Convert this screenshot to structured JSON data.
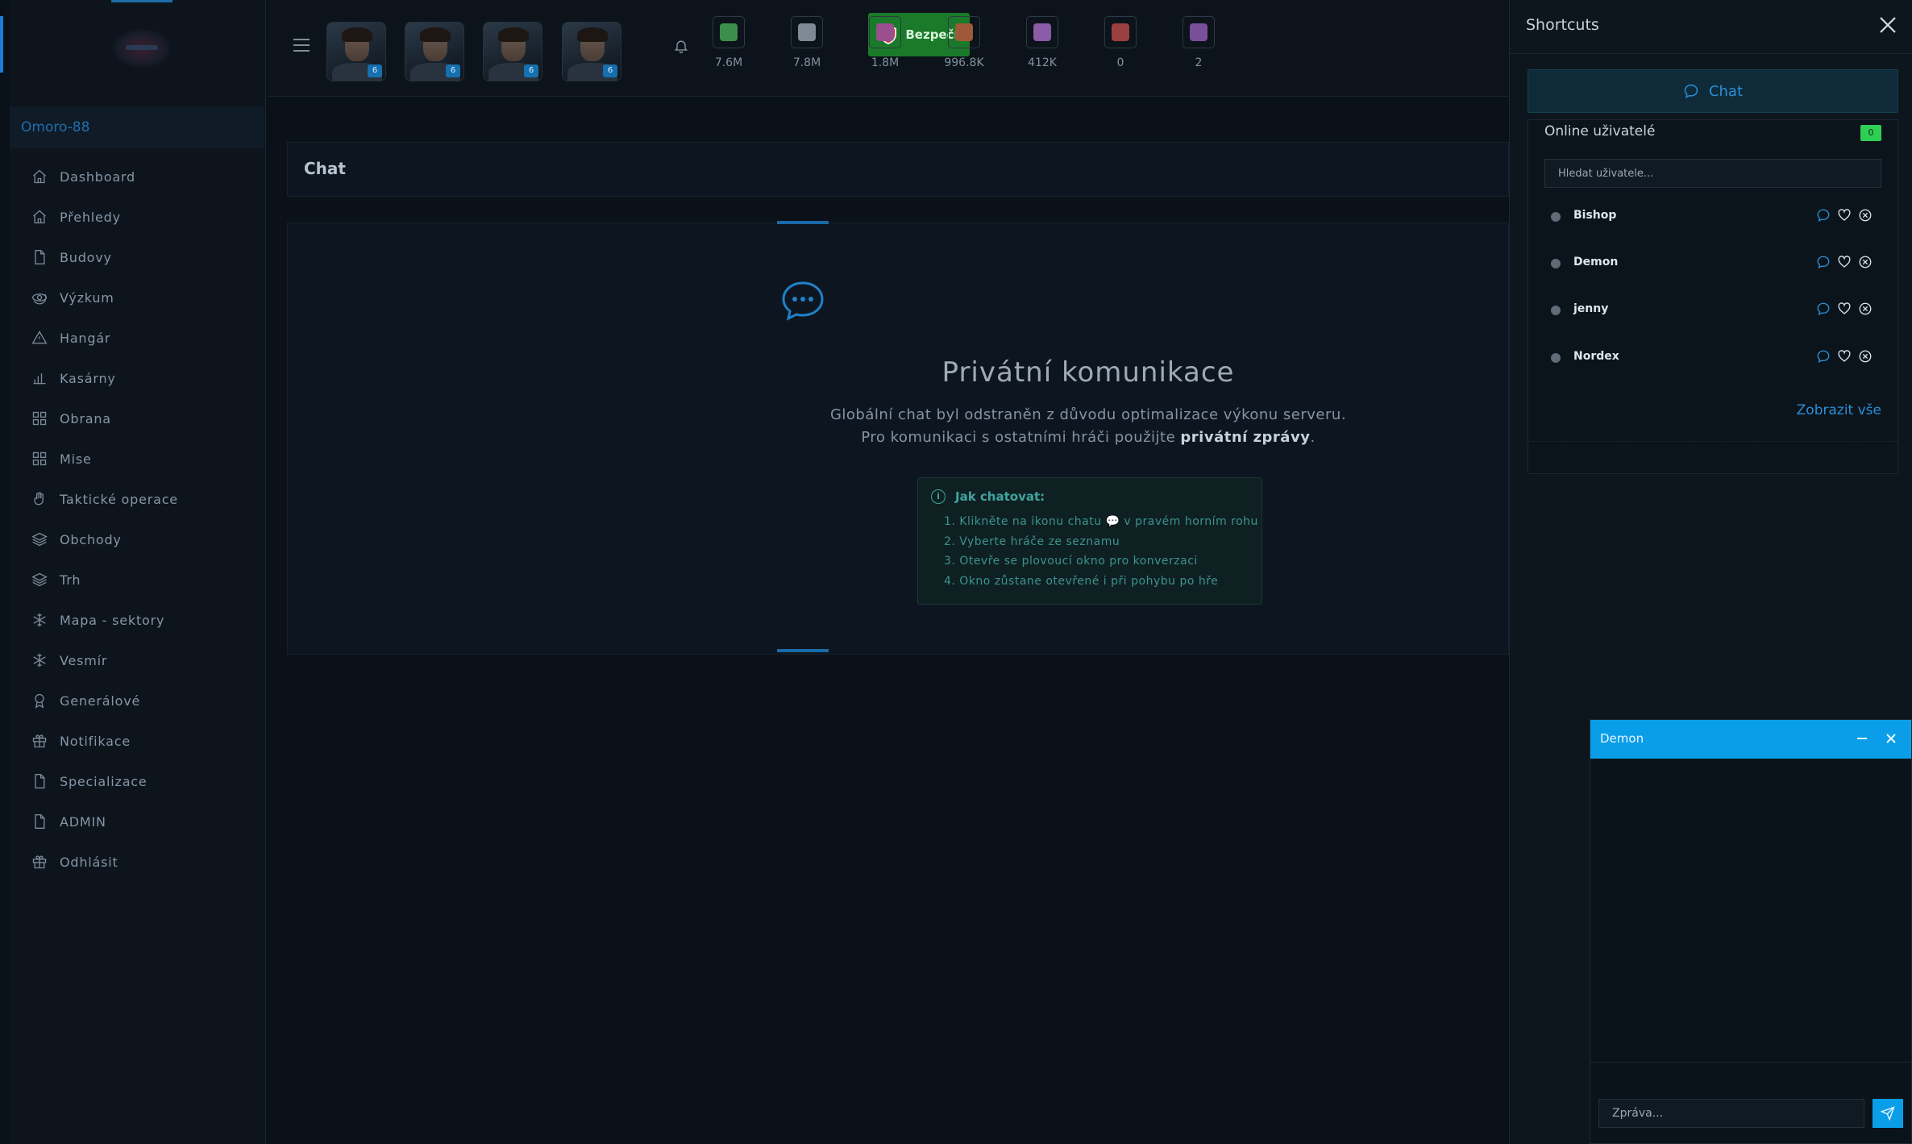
{
  "sidebar": {
    "username": "Omoro-88",
    "items": [
      {
        "label": "Dashboard",
        "icon": "home-icon"
      },
      {
        "label": "Přehledy",
        "icon": "home-icon"
      },
      {
        "label": "Budovy",
        "icon": "file-icon"
      },
      {
        "label": "Výzkum",
        "icon": "orbit-icon"
      },
      {
        "label": "Hangár",
        "icon": "warning-icon"
      },
      {
        "label": "Kasárny",
        "icon": "bar-chart-icon"
      },
      {
        "label": "Obrana",
        "icon": "grid-icon"
      },
      {
        "label": "Mise",
        "icon": "grid-icon"
      },
      {
        "label": "Taktické operace",
        "icon": "hand-icon"
      },
      {
        "label": "Obchody",
        "icon": "layers-icon"
      },
      {
        "label": "Trh",
        "icon": "layers-icon"
      },
      {
        "label": "Mapa - sektory",
        "icon": "snowflake-icon"
      },
      {
        "label": "Vesmír",
        "icon": "snowflake-icon"
      },
      {
        "label": "Generálové",
        "icon": "award-icon"
      },
      {
        "label": "Notifikace",
        "icon": "gift-icon"
      },
      {
        "label": "Specializace",
        "icon": "file-icon"
      },
      {
        "label": "ADMIN",
        "icon": "file-icon"
      },
      {
        "label": "Odhlásit",
        "icon": "gift-icon"
      }
    ]
  },
  "topbar": {
    "portraits": [
      {
        "badge": "6"
      },
      {
        "badge": "6"
      },
      {
        "badge": "6"
      },
      {
        "badge": "6"
      }
    ],
    "security_label": "Bezpečí",
    "resources": [
      {
        "value": "7.6M",
        "color": "#3c8f4a"
      },
      {
        "value": "7.8M",
        "color": "#7d8a96"
      },
      {
        "value": "1.8M",
        "color": "#9a4f8f"
      },
      {
        "value": "996.8K",
        "color": "#a0583a"
      },
      {
        "value": "412K",
        "color": "#8a5ba6"
      },
      {
        "value": "0",
        "color": "#9a4040"
      },
      {
        "value": "2",
        "color": "#7a4f9a"
      }
    ]
  },
  "main": {
    "title": "Chat",
    "heading": "Privátní komunikace",
    "desc_line1": "Globální chat byl odstraněn z důvodu optimalizace výkonu serveru.",
    "desc_line2_prefix": "Pro komunikaci s ostatními hráči použijte ",
    "desc_line2_bold": "privátní zprávy",
    "desc_line2_suffix": ".",
    "howto_title": "Jak chatovat:",
    "howto_steps": [
      "1. Klikněte na ikonu chatu 💬 v pravém horním rohu",
      "2. Vyberte hráče ze seznamu",
      "3. Otevře se plovoucí okno pro konverzaci",
      "4. Okno zůstane otevřené i při pohybu po hře"
    ]
  },
  "shortcuts": {
    "title": "Shortcuts",
    "chat_tab": "Chat",
    "online_title": "Online uživatelé",
    "online_count": "0",
    "search_placeholder": "Hledat uživatele...",
    "users": [
      "Bishop",
      "Demon",
      "jenny",
      "Nordex"
    ],
    "show_all": "Zobrazit vše"
  },
  "chat_window": {
    "title": "Demon",
    "input_placeholder": "Zpráva..."
  }
}
